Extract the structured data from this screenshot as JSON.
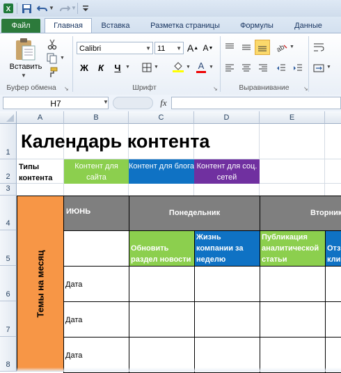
{
  "qat": {
    "icons": [
      "excel-logo-icon",
      "save-icon",
      "undo-icon",
      "redo-icon",
      "customize-icon"
    ]
  },
  "tabs": [
    {
      "label": "Файл"
    },
    {
      "label": "Главная"
    },
    {
      "label": "Вставка"
    },
    {
      "label": "Разметка страницы"
    },
    {
      "label": "Формулы"
    },
    {
      "label": "Данные"
    }
  ],
  "ribbon": {
    "clipboard": {
      "paste_label": "Вставить",
      "group_label": "Буфер обмена"
    },
    "font": {
      "name": "Calibri",
      "size": "11",
      "bold": "Ж",
      "italic": "К",
      "underline": "Ч",
      "group_label": "Шрифт",
      "grow": "A",
      "shrink": "A",
      "font_color_letter": "A"
    },
    "alignment": {
      "group_label": "Выравнивание"
    }
  },
  "formula_bar": {
    "name_box": "H7",
    "fx": "fx",
    "value": ""
  },
  "columns": [
    "A",
    "B",
    "C",
    "D",
    "E"
  ],
  "rows": [
    "1",
    "2",
    "3",
    "4",
    "5",
    "6",
    "7",
    "8"
  ],
  "sheet": {
    "title": "Календарь контента",
    "types_label": "Типы контента",
    "legend": [
      {
        "label": "Контент для сайта",
        "color": "#8ccf4e"
      },
      {
        "label": "Контент для блога",
        "color": "#0f72c4"
      },
      {
        "label": "Контент для соц. сетей",
        "color": "#7030a0"
      }
    ],
    "themes_label": "Темы на месяц",
    "themes_color": "#f79646",
    "month_label": "ИЮНЬ",
    "header_color": "#7f7f7f",
    "days": [
      "Понедельник",
      "Вторник"
    ],
    "tasks": [
      {
        "label": "Обновить раздел новости",
        "color": "#8ccf4e"
      },
      {
        "label": "Жизнь компании за неделю",
        "color": "#0f72c4"
      },
      {
        "label": "Публикация аналитической статьи",
        "color": "#8ccf4e"
      },
      {
        "label": "Отз кли",
        "color": "#0f72c4"
      }
    ],
    "date_labels": [
      "Дата",
      "Дата",
      "Дата"
    ]
  }
}
